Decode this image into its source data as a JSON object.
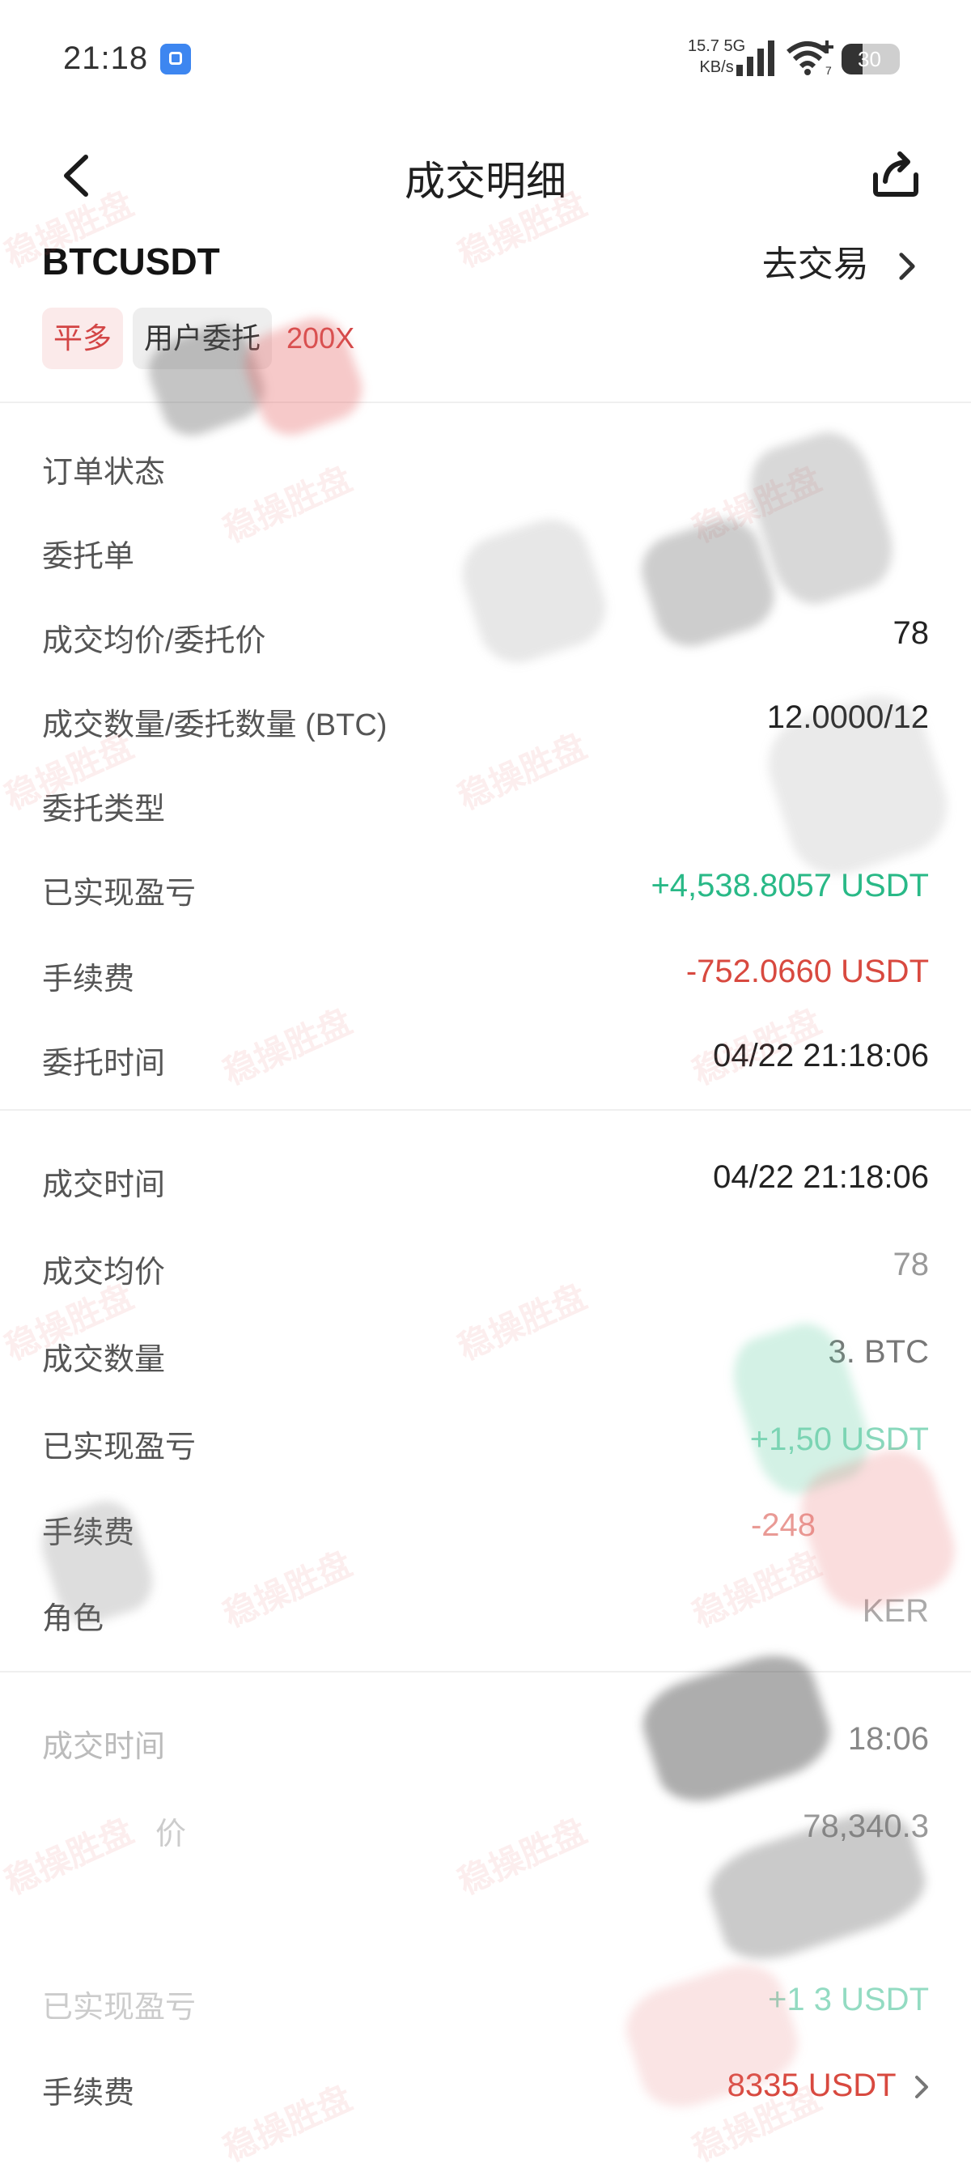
{
  "status_bar": {
    "time": "21:18",
    "net_speed": "15.7",
    "net_unit": "KB/s",
    "net_type": "5G",
    "wifi_number": "7",
    "battery": "30"
  },
  "nav": {
    "title": "成交明细",
    "back_icon": "chevron-left-icon",
    "share_icon": "share-icon"
  },
  "header": {
    "symbol": "BTCUSDT",
    "goto_trade": "去交易",
    "tags": [
      "平多",
      "用户委托",
      "200X"
    ]
  },
  "order": {
    "rows": [
      {
        "label": "订单状态",
        "value": ""
      },
      {
        "label": "委托单",
        "value": ""
      },
      {
        "label": "成交均价/委托价",
        "value": "78"
      },
      {
        "label": "成交数量/委托数量 (BTC)",
        "value": "12.0000/12"
      },
      {
        "label": "委托类型",
        "value": ""
      },
      {
        "label": "已实现盈亏",
        "value": "+4,538.8057 USDT"
      },
      {
        "label": "手续费",
        "value": "-752.0660 USDT"
      },
      {
        "label": "委托时间",
        "value": "04/22 21:18:06"
      }
    ]
  },
  "fill1": {
    "rows": [
      {
        "label": "成交时间",
        "value": "04/22 21:18:06"
      },
      {
        "label": "成交均价",
        "value": "78"
      },
      {
        "label": "成交数量",
        "value": "3. BTC"
      },
      {
        "label": "已实现盈亏",
        "value": "+1,50 USDT"
      },
      {
        "label": "手续费",
        "value": "-248"
      },
      {
        "label": "角色",
        "value": "KER"
      }
    ]
  },
  "fill2": {
    "rows": [
      {
        "label": "成交时间",
        "value": "18:06"
      },
      {
        "label": "价",
        "value": "78,340.3"
      },
      {
        "label": "",
        "value": ""
      },
      {
        "label": "已实现盈亏",
        "value": "+1 3 USDT"
      },
      {
        "label": "手续费",
        "value": "8335 USDT"
      }
    ]
  },
  "watermark": "稳操胜盘",
  "colors": {
    "profit": "#29b987",
    "loss": "#d8493f"
  }
}
